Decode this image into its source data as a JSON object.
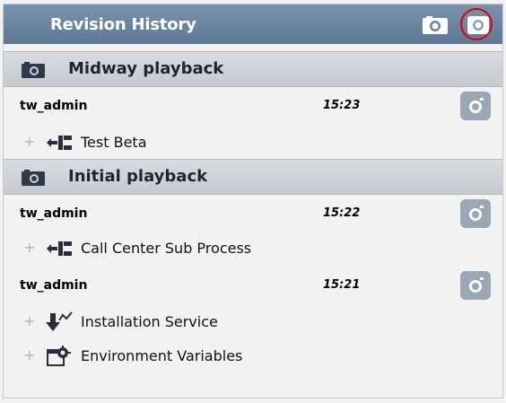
{
  "panel": {
    "title": "Revision History",
    "header_buttons": {
      "snapshot_icon": "camera-icon",
      "toggle_icon": "circle-icon",
      "highlight_color": "#e00000"
    }
  },
  "groups": [
    {
      "title": "Midway playback",
      "icon": "camera-icon",
      "revisions": [
        {
          "user": "tw_admin",
          "time": "15:23",
          "items": [
            {
              "label": "Test Beta",
              "icon": "process-icon",
              "expander": "+"
            }
          ]
        }
      ]
    },
    {
      "title": "Initial playback",
      "icon": "camera-icon",
      "revisions": [
        {
          "user": "tw_admin",
          "time": "15:22",
          "items": [
            {
              "label": "Call Center Sub Process",
              "icon": "process-icon",
              "expander": "+"
            }
          ]
        },
        {
          "user": "tw_admin",
          "time": "15:21",
          "items": [
            {
              "label": "Installation Service",
              "icon": "service-icon",
              "expander": "+"
            },
            {
              "label": "Environment Variables",
              "icon": "environment-icon",
              "expander": "+"
            }
          ]
        }
      ]
    }
  ],
  "colors": {
    "header_bg": "#6a83a0",
    "group_bg": "#cfd3d8",
    "panel_bg": "#f2f2f2",
    "snapshot_button": "#9aa8b6"
  }
}
